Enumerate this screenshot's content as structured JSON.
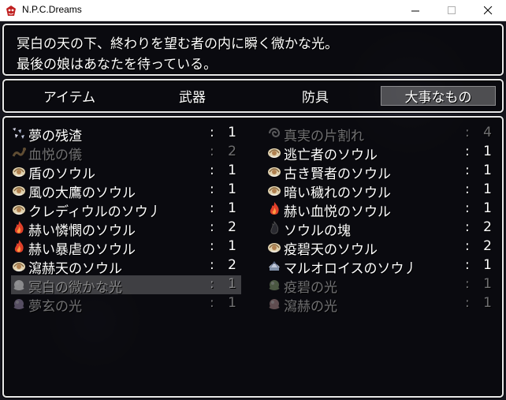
{
  "window": {
    "title": "N.P.C.Dreams",
    "minimize_glyph": "—",
    "maximize_glyph": "☐",
    "close_glyph": "✕"
  },
  "help": {
    "line1": "冥白の天の下、終わりを望む者の内に瞬く微かな光。",
    "line2": "最後の娘はあなたを待っている。"
  },
  "categories": [
    {
      "label": "アイテム",
      "selected": false
    },
    {
      "label": "武器",
      "selected": false
    },
    {
      "label": "防具",
      "selected": false
    },
    {
      "label": "大事なもの",
      "selected": true
    }
  ],
  "items": [
    {
      "name": "夢の残渣",
      "colon": ":",
      "count": "1",
      "icon": "fragments-icon",
      "enabled": true
    },
    {
      "name": "真実の片割れ",
      "colon": ":",
      "count": "4",
      "icon": "swirl-icon",
      "enabled": false
    },
    {
      "name": "血悦の儀",
      "colon": ":",
      "count": "2",
      "icon": "serpent-icon",
      "enabled": false
    },
    {
      "name": "逃亡者のソウル",
      "colon": ":",
      "count": "1",
      "icon": "soul-icon",
      "enabled": true
    },
    {
      "name": "盾のソウル",
      "colon": ":",
      "count": "1",
      "icon": "soul-icon",
      "enabled": true
    },
    {
      "name": "古き賢者のソウル",
      "colon": ":",
      "count": "1",
      "icon": "soul-icon",
      "enabled": true
    },
    {
      "name": "風の大鷹のソウル",
      "colon": ":",
      "count": "1",
      "icon": "soul-icon",
      "enabled": true
    },
    {
      "name": "暗い穢れのソウル",
      "colon": ":",
      "count": "1",
      "icon": "soul-icon",
      "enabled": true
    },
    {
      "name": "クレディウルのソウ丿",
      "colon": ":",
      "count": "1",
      "icon": "soul-icon",
      "enabled": true
    },
    {
      "name": "赫い血悦のソウル",
      "colon": ":",
      "count": "1",
      "icon": "flame-icon",
      "enabled": true
    },
    {
      "name": "赫い憐憫のソウル",
      "colon": ":",
      "count": "2",
      "icon": "flame-icon",
      "enabled": true
    },
    {
      "name": "ソウルの塊",
      "colon": ":",
      "count": "2",
      "icon": "dark-flame-icon",
      "enabled": true
    },
    {
      "name": "赫い暴虐のソウル",
      "colon": ":",
      "count": "1",
      "icon": "flame-icon",
      "enabled": true
    },
    {
      "name": "疫碧天のソウル",
      "colon": ":",
      "count": "2",
      "icon": "soul-icon",
      "enabled": true
    },
    {
      "name": "瀉赫天のソウル",
      "colon": ":",
      "count": "2",
      "icon": "soul-icon",
      "enabled": true
    },
    {
      "name": "マルオロイスのソウ丿",
      "colon": ":",
      "count": "1",
      "icon": "shell-icon",
      "enabled": true
    },
    {
      "name": "冥白の微かな光",
      "colon": ":",
      "count": "1",
      "icon": "white-light-icon",
      "enabled": false,
      "selected": true
    },
    {
      "name": "疫碧の光",
      "colon": ":",
      "count": "1",
      "icon": "green-light-icon",
      "enabled": false
    },
    {
      "name": "夢玄の光",
      "colon": ":",
      "count": "1",
      "icon": "dream-light-icon",
      "enabled": false
    },
    {
      "name": "瀉赫の光",
      "colon": ":",
      "count": "1",
      "icon": "red-light-icon",
      "enabled": false
    }
  ],
  "colors": {
    "window_bg": "#08080c",
    "border": "#e8e8e8",
    "text": "#ffffff",
    "flame": "#e0402a",
    "soul": "#d8c8a8"
  }
}
